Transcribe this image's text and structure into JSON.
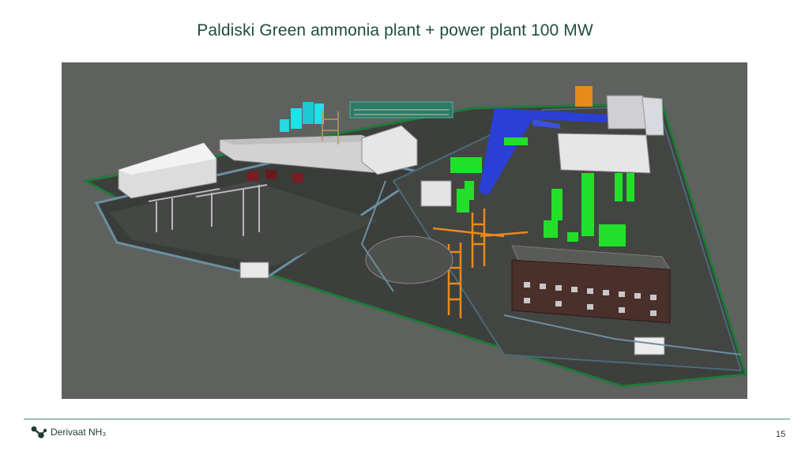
{
  "slide": {
    "title": "Paldiski Green ammonia plant + power plant 100 MW",
    "page_number": "15"
  },
  "logo": {
    "text": "Derivaat NH₃"
  },
  "colors": {
    "title": "#1f4e3d",
    "footer_rule": "#4f8a79",
    "scene_background": "#5e615e",
    "equipment_green": "#22e02a",
    "pipe_blue": "#2a3fd6",
    "structure_orange": "#e88a1a",
    "tank_cyan": "#20e0e8"
  }
}
